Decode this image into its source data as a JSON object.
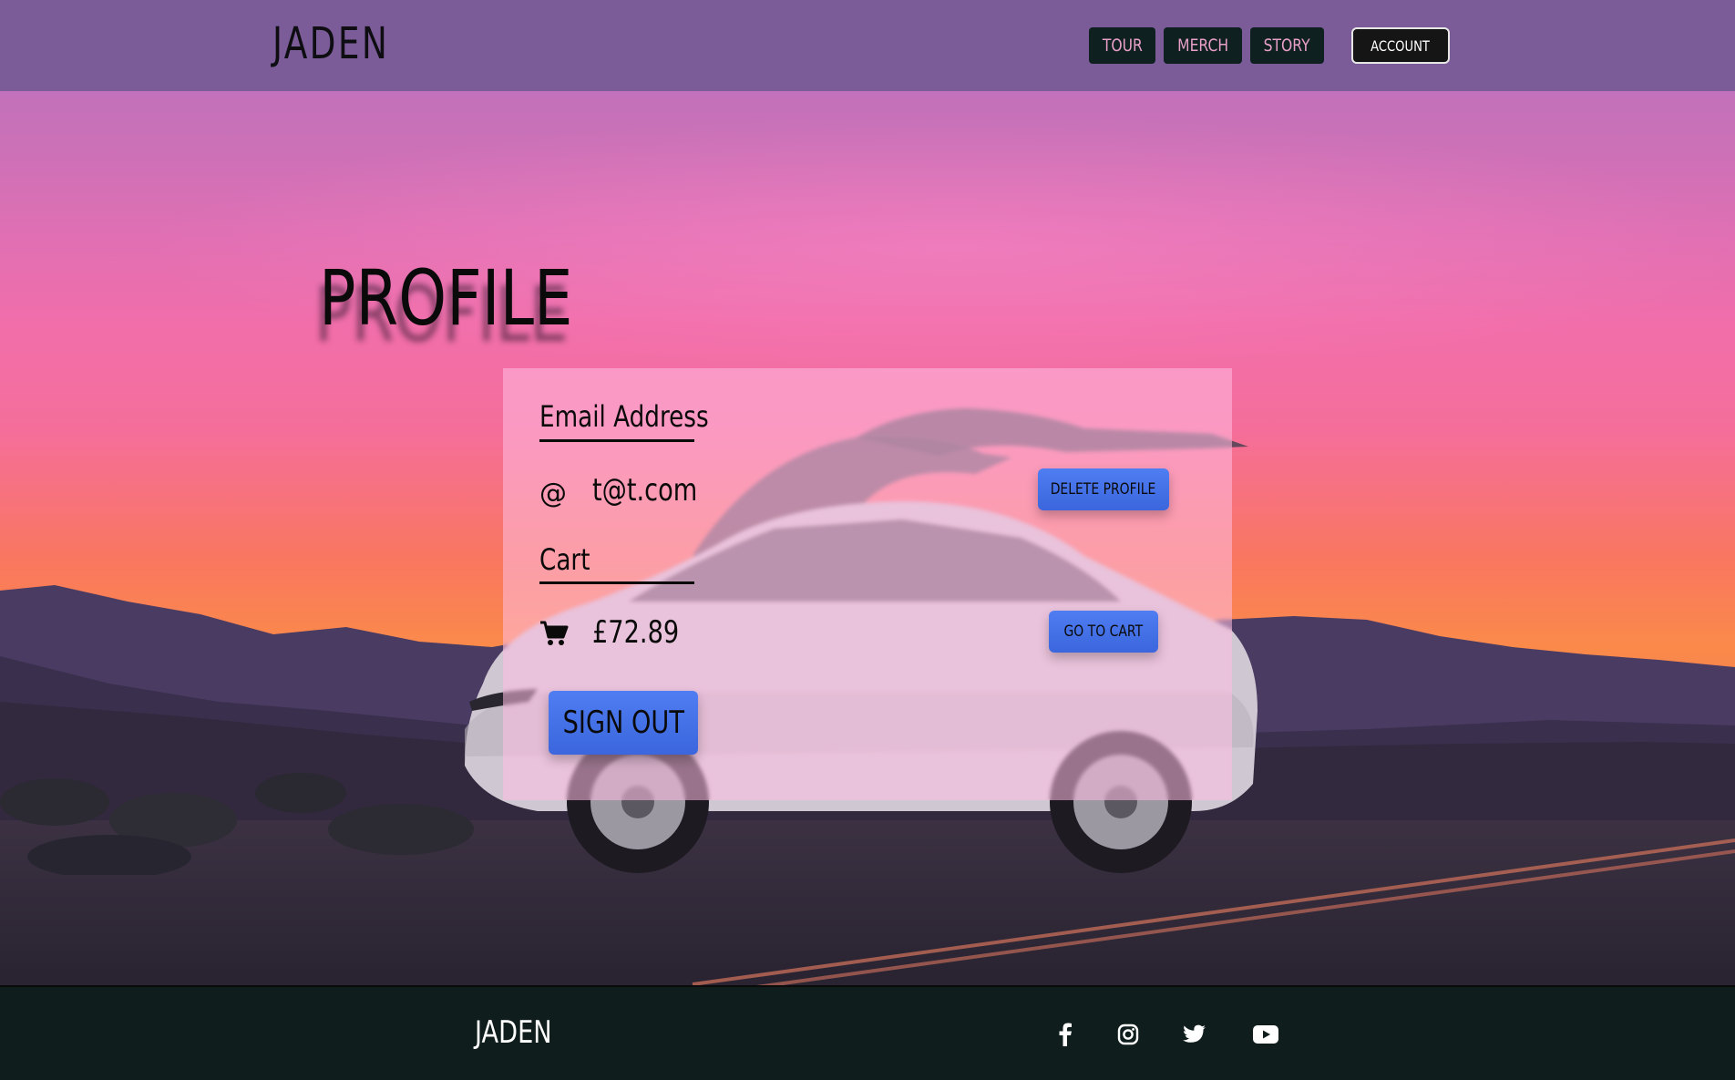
{
  "header": {
    "brand": "JADEN",
    "nav": [
      {
        "label": "TOUR"
      },
      {
        "label": "MERCH"
      },
      {
        "label": "STORY"
      }
    ],
    "account_label": "ACCOUNT"
  },
  "page": {
    "title": "PROFILE"
  },
  "profile": {
    "email_label": "Email Address",
    "email_icon": "@",
    "email_value": "t@t.com",
    "delete_button": "DELETE PROFILE",
    "cart_label": "Cart",
    "cart_icon": "shopping-cart-icon",
    "cart_total": "£72.89",
    "go_to_cart_button": "GO TO CART",
    "sign_out_button": "SIGN OUT"
  },
  "footer": {
    "brand": "JADEN",
    "social_icons": [
      "facebook-icon",
      "instagram-icon",
      "twitter-icon",
      "youtube-icon"
    ]
  },
  "colors": {
    "header_bg": "#7c5c98",
    "nav_button_bg": "#0f2021",
    "nav_button_text": "#e8a0c8",
    "card_button_blue": "#4f7df2",
    "footer_bg": "#0f1d1d"
  }
}
